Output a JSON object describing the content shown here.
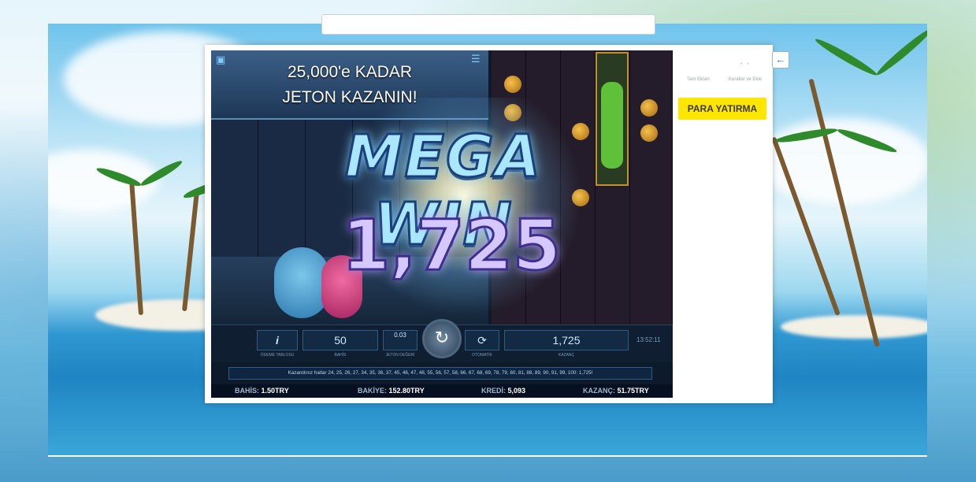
{
  "browser": {
    "site_brand": ""
  },
  "promo": {
    "line1": "25,000'e KADAR",
    "line2": "JETON KAZANIN!"
  },
  "win": {
    "title": "MEGA WIN",
    "amount": "1,725"
  },
  "controls": {
    "info_label": "i",
    "info_caption": "ÖDEME TABLOSU",
    "bet_value": "50",
    "bet_caption": "BAHİS",
    "coin_value": "0.03",
    "coin_caption": "JETON DEĞERİ",
    "auto_caption": "OTOMATİK",
    "win_value": "1,725",
    "win_caption": "KAZANÇ",
    "clock": "13:52:11"
  },
  "winlines_text": "Kazandınız hatlar 24, 25, 26, 27, 34, 35, 36, 37, 45, 46, 47, 48, 55, 56, 57, 58, 66, 67, 68, 69, 78, 79, 80, 81, 88, 89, 90, 91, 99, 100: 1,725!",
  "status_bar": {
    "bet_label": "BAHİS:",
    "bet_value": "1.50TRY",
    "balance_label": "BAKİYE:",
    "balance_value": "152.80TRY",
    "credit_label": "KREDİ:",
    "credit_value": "5,093",
    "win_label": "KAZANÇ:",
    "win_value": "51.75TRY"
  },
  "sidebar": {
    "link1": "Tam Ekran",
    "link2": "Kurallar ve Ekle",
    "deposit_button": "PARA YATIRMA",
    "back_icon": "back-arrow-icon"
  },
  "colors": {
    "deposit_bg": "#ffe600",
    "game_bg": "#0d1a2b",
    "win_text": "#a9e7ff"
  }
}
